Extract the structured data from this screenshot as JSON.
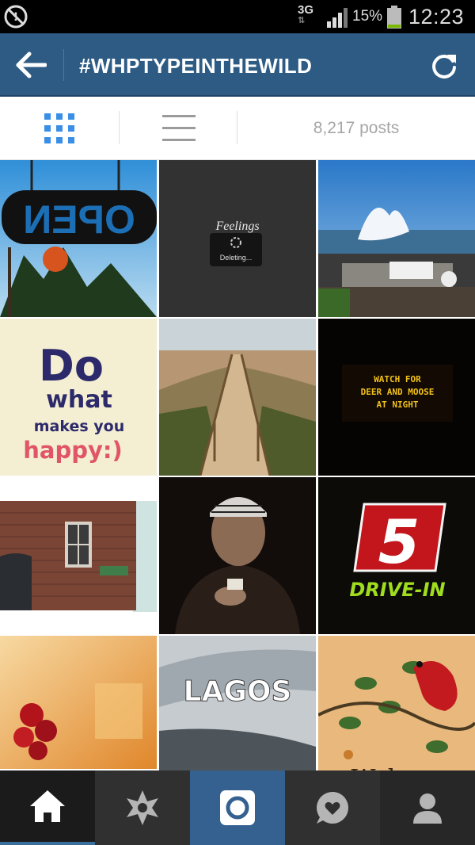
{
  "status_bar": {
    "network": "3G",
    "battery_percent": "15%",
    "battery_level": 0.15,
    "time": "12:23"
  },
  "header": {
    "title": "#WHPTYPEINTHEWILD"
  },
  "toggle_bar": {
    "post_count": "8,217 posts",
    "active_view": "grid"
  },
  "grid": {
    "tiles": [
      {
        "description": "open-sign",
        "text": "OPEN"
      },
      {
        "description": "feelings-deleting",
        "text": "Feelings",
        "subtext": "Deleting..."
      },
      {
        "description": "ocean-waves"
      },
      {
        "description": "do-what-makes-you-happy",
        "text": "Do",
        "line2": "what",
        "line3": "makes you",
        "line4": "happy:)"
      },
      {
        "description": "boardwalk-dunes"
      },
      {
        "description": "neon-sign",
        "text": "WATCH FOR",
        "line2": "DEER AND MOOSE",
        "line3": "AT NIGHT"
      },
      {
        "description": "brick-building"
      },
      {
        "description": "old-man-portrait"
      },
      {
        "description": "drive-in-sign",
        "text": "5",
        "line2": "DRIVE-IN"
      },
      {
        "description": "roses"
      },
      {
        "description": "lagos-sign",
        "text": "LAGOS"
      },
      {
        "description": "cardinal-welcome",
        "text": "Welcome"
      }
    ]
  },
  "colors": {
    "actionbar": "#2d5b84",
    "accent": "#3a8ee6",
    "nav_active": "#356191"
  },
  "bottom_nav": {
    "items": [
      "home-icon",
      "explore-icon",
      "camera-icon",
      "news-icon",
      "profile-icon"
    ],
    "active": "home"
  }
}
